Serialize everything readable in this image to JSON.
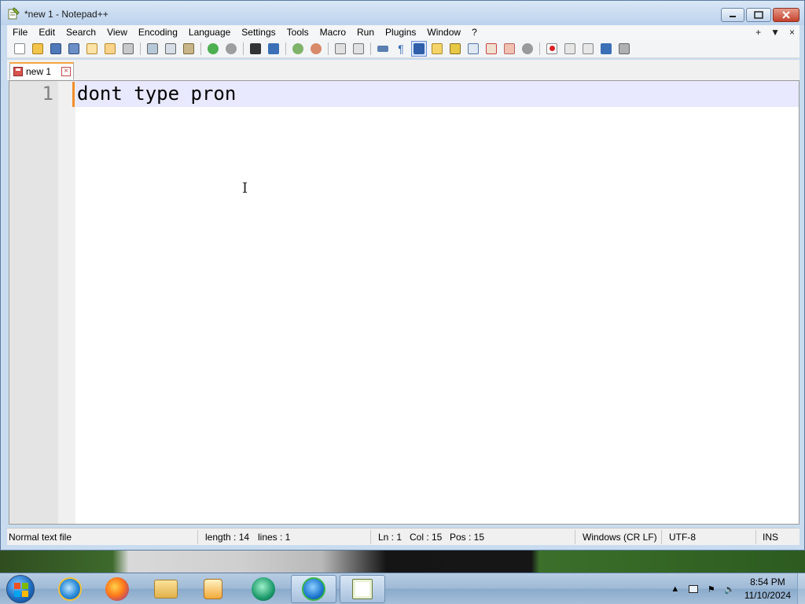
{
  "window": {
    "title": "*new 1 - Notepad++"
  },
  "menu": {
    "items": [
      "File",
      "Edit",
      "Search",
      "View",
      "Encoding",
      "Language",
      "Settings",
      "Tools",
      "Macro",
      "Run",
      "Plugins",
      "Window",
      "?"
    ],
    "right": {
      "plus": "+",
      "dropdown": "▼",
      "close": "×"
    }
  },
  "tab": {
    "label": "new 1",
    "close": "×"
  },
  "editor": {
    "line_number": "1",
    "content": "dont type pron",
    "cursor": "I"
  },
  "status": {
    "file_type": "Normal text file",
    "length": "length : 14",
    "lines": "lines : 1",
    "ln": "Ln : 1",
    "col": "Col : 15",
    "pos": "Pos : 15",
    "eol": "Windows (CR LF)",
    "encoding": "UTF-8",
    "mode": "INS"
  },
  "taskbar": {
    "time": "8:54 PM",
    "date": "11/10/2024"
  },
  "colors": {
    "accent_orange": "#f08d2a",
    "current_line": "#e8e8ff",
    "titlebar": "#c9dcef"
  }
}
